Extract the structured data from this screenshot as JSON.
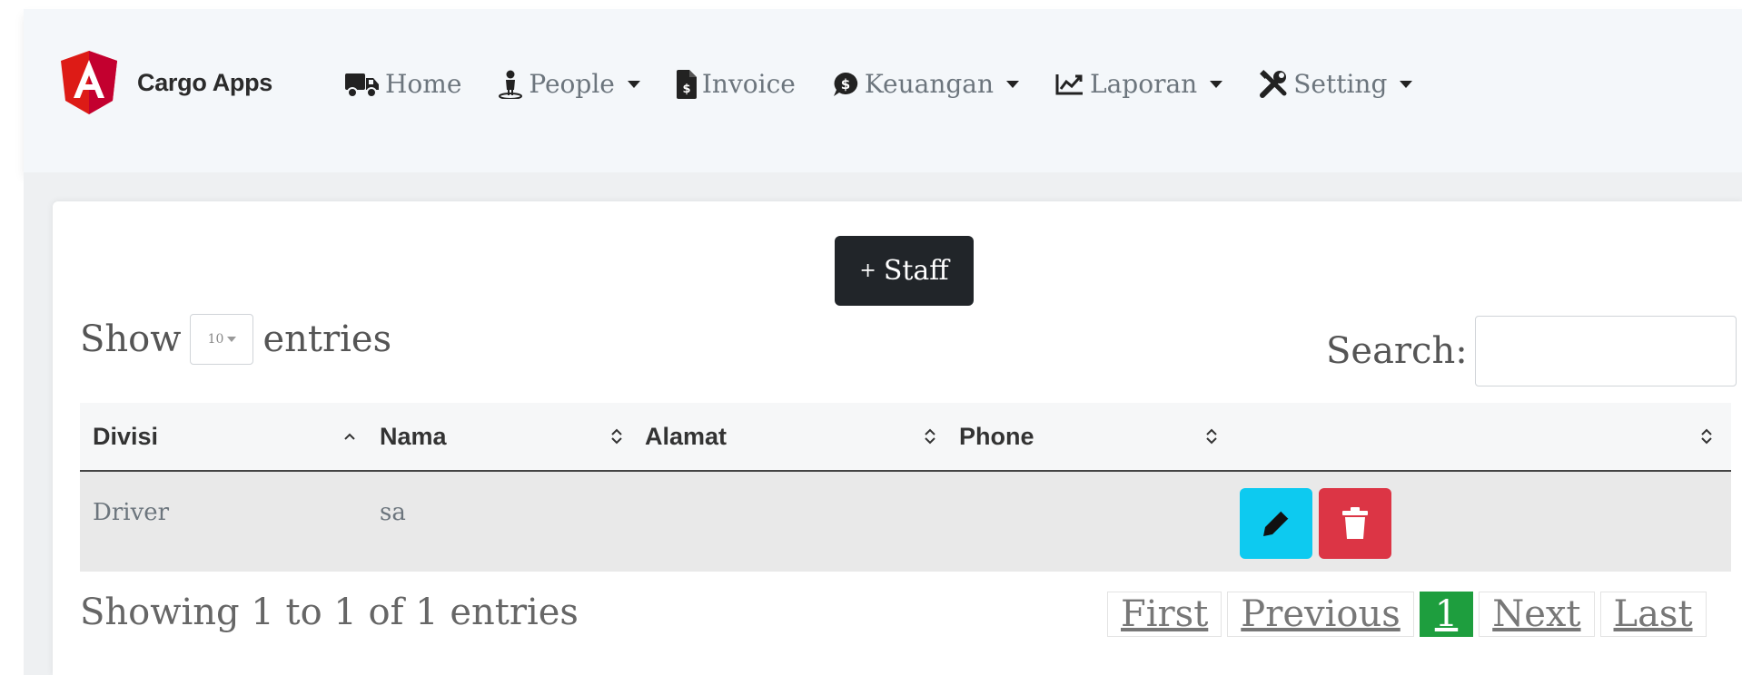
{
  "app": {
    "name": "Cargo Apps",
    "logo_icon": "angular-logo-icon",
    "logo_letter": "A"
  },
  "nav": [
    {
      "label": "Home",
      "icon": "truck-icon",
      "dropdown": false
    },
    {
      "label": "People",
      "icon": "person-icon",
      "dropdown": true
    },
    {
      "label": "Invoice",
      "icon": "invoice-icon",
      "dropdown": false
    },
    {
      "label": "Keuangan",
      "icon": "money-icon",
      "dropdown": true
    },
    {
      "label": "Laporan",
      "icon": "chart-line-icon",
      "dropdown": true
    },
    {
      "label": "Setting",
      "icon": "tools-icon",
      "dropdown": true
    }
  ],
  "actions": {
    "add_staff_plus": "+",
    "add_staff_label": "Staff"
  },
  "length_menu": {
    "prefix": "Show",
    "selected": "10",
    "suffix": "entries"
  },
  "search": {
    "label": "Search:",
    "value": ""
  },
  "table": {
    "columns": [
      "Divisi",
      "Nama",
      "Alamat",
      "Phone",
      ""
    ],
    "rows": [
      {
        "divisi": "Driver",
        "nama": "sa",
        "alamat": "",
        "phone": ""
      }
    ]
  },
  "footer": {
    "info": "Showing 1 to 1 of 1 entries",
    "pager": {
      "first": "First",
      "previous": "Previous",
      "current": "1",
      "next": "Next",
      "last": "Last"
    }
  },
  "colors": {
    "navbar_bg": "#f4f7fa",
    "brand_red": "#dd1b16",
    "staff_button": "#212529",
    "edit_button": "#0dcaf0",
    "delete_button": "#dc3545",
    "active_page": "#1e9e3e"
  }
}
